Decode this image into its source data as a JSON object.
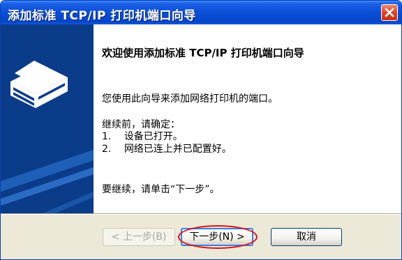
{
  "window": {
    "title": "添加标准 TCP/IP 打印机端口向导"
  },
  "content": {
    "heading": "欢迎使用添加标准 TCP/IP 打印机端口向导",
    "description": "您使用此向导来添加网络打印机的端口。",
    "before_continue": "继续前，请确定：",
    "items": [
      {
        "num": "1.",
        "text": "设备已打开。"
      },
      {
        "num": "2.",
        "text": "网络已连上并已配置好。"
      }
    ],
    "continue_text": "要继续，请单击“下一步”。"
  },
  "buttons": {
    "back": "< 上一步(B)",
    "next": "下一步(N) >",
    "cancel": "取消"
  },
  "colors": {
    "title_bar": "#0a4fd6",
    "sidebar": "#0b3c8a",
    "highlight": "#d8101a"
  }
}
